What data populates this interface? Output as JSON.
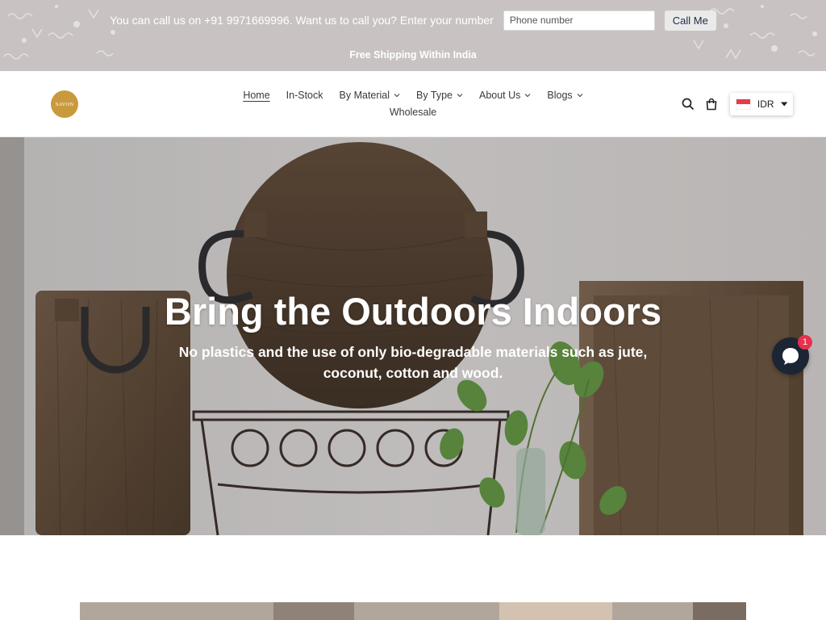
{
  "topbar": {
    "call_text": "You can call us on +91 9971669996. Want us to call you? Enter your number",
    "phone_placeholder": "Phone number",
    "call_button": "Call Me",
    "shipping_text": "Free Shipping Within India"
  },
  "header": {
    "logo_text": "SAVON",
    "nav": [
      {
        "label": "Home",
        "dropdown": false,
        "active": true
      },
      {
        "label": "In-Stock",
        "dropdown": false
      },
      {
        "label": "By Material",
        "dropdown": true
      },
      {
        "label": "By Type",
        "dropdown": true
      },
      {
        "label": "About Us",
        "dropdown": true
      },
      {
        "label": "Blogs",
        "dropdown": true
      },
      {
        "label": "Wholesale",
        "dropdown": false
      }
    ],
    "currency": "IDR"
  },
  "hero": {
    "title": "Bring the Outdoors Indoors",
    "subtitle": "No plastics and the use of only bio-degradable materials such as jute, coconut, cotton and wood."
  },
  "chat": {
    "badge_count": "1"
  },
  "colors": {
    "topbar": "#c8c3c2",
    "logo": "#c99a3d",
    "chat": "#1c2533",
    "badge": "#e8304f"
  }
}
